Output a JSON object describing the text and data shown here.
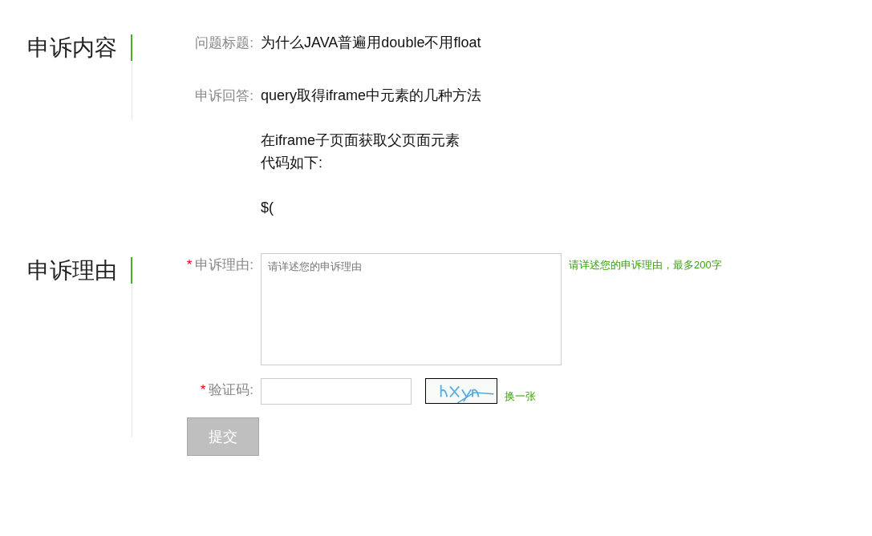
{
  "sections": [
    {
      "title": "申诉内容",
      "fields": [
        {
          "kind": "text",
          "label": "问题标题:",
          "paragraphs": [
            [
              "为什么JAVA普遍用double不用float"
            ]
          ]
        },
        {
          "kind": "text",
          "label": "申诉回答:",
          "paragraphs": [
            [
              "query取得iframe中元素的几种方法"
            ],
            [
              "在iframe子页面获取父页面元素",
              "代码如下:"
            ],
            [
              "$("
            ]
          ]
        }
      ]
    },
    {
      "title": "申诉理由",
      "fields": [
        {
          "kind": "textarea",
          "required": true,
          "required_mark": "*",
          "label": "申诉理由:",
          "placeholder": "请详述您的申诉理由",
          "hint": "请详述您的申诉理由，最多200字"
        },
        {
          "kind": "captcha",
          "required": true,
          "required_mark": "*",
          "label": "验证码:",
          "refresh": "换一张"
        },
        {
          "kind": "submit",
          "label": "提交"
        }
      ]
    }
  ]
}
